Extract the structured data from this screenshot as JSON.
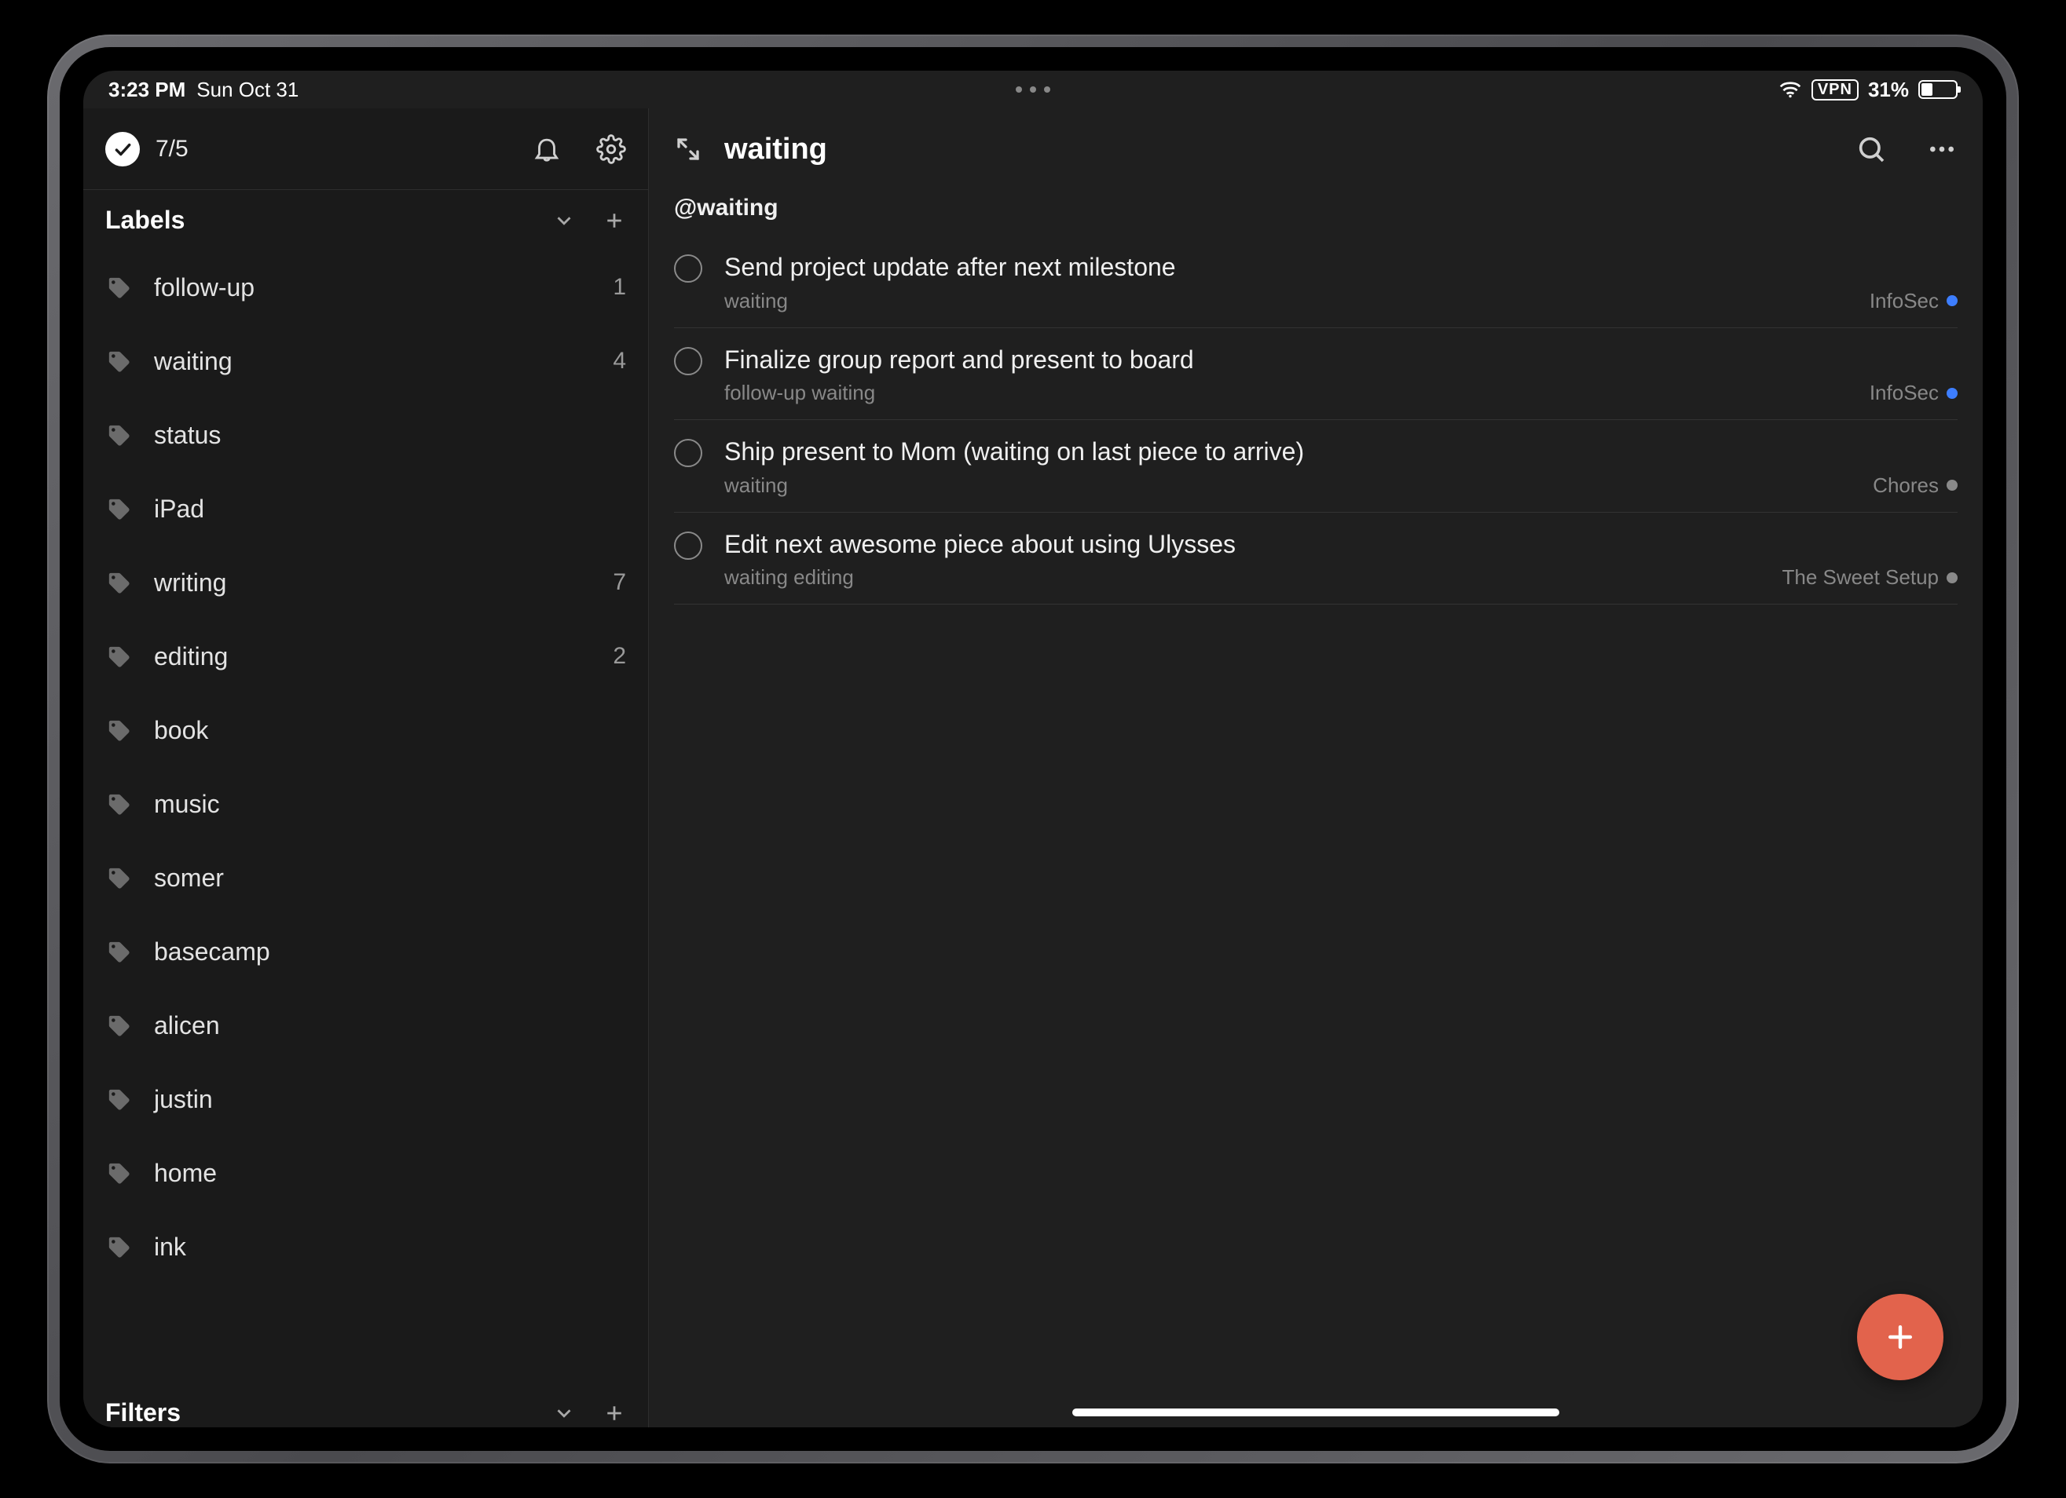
{
  "status_bar": {
    "time": "3:23 PM",
    "date": "Sun Oct 31",
    "vpn": "VPN",
    "battery_percent": "31%"
  },
  "sidebar": {
    "today_count": "7/5",
    "sections": {
      "labels_title": "Labels",
      "filters_title": "Filters"
    },
    "labels": [
      {
        "name": "follow-up",
        "count": "1"
      },
      {
        "name": "waiting",
        "count": "4"
      },
      {
        "name": "status",
        "count": ""
      },
      {
        "name": "iPad",
        "count": ""
      },
      {
        "name": "writing",
        "count": "7"
      },
      {
        "name": "editing",
        "count": "2"
      },
      {
        "name": "book",
        "count": ""
      },
      {
        "name": "music",
        "count": ""
      },
      {
        "name": "somer",
        "count": ""
      },
      {
        "name": "basecamp",
        "count": ""
      },
      {
        "name": "alicen",
        "count": ""
      },
      {
        "name": "justin",
        "count": ""
      },
      {
        "name": "home",
        "count": ""
      },
      {
        "name": "ink",
        "count": ""
      }
    ]
  },
  "main": {
    "title": "waiting",
    "group_header": "@waiting",
    "tasks": [
      {
        "title": "Send project update after next milestone",
        "labels": "waiting",
        "project_name": "InfoSec",
        "project_color": "#3d7eff"
      },
      {
        "title": "Finalize group report and present to board",
        "labels": "follow-up waiting",
        "project_name": "InfoSec",
        "project_color": "#3d7eff"
      },
      {
        "title": "Ship present to Mom (waiting on last piece to arrive)",
        "labels": "waiting",
        "project_name": "Chores",
        "project_color": "#8a8a8a"
      },
      {
        "title": "Edit next awesome piece about using Ulysses",
        "labels": "waiting editing",
        "project_name": "The Sweet Setup",
        "project_color": "#8a8a8a"
      }
    ]
  },
  "colors": {
    "accent": "#e2634c"
  }
}
